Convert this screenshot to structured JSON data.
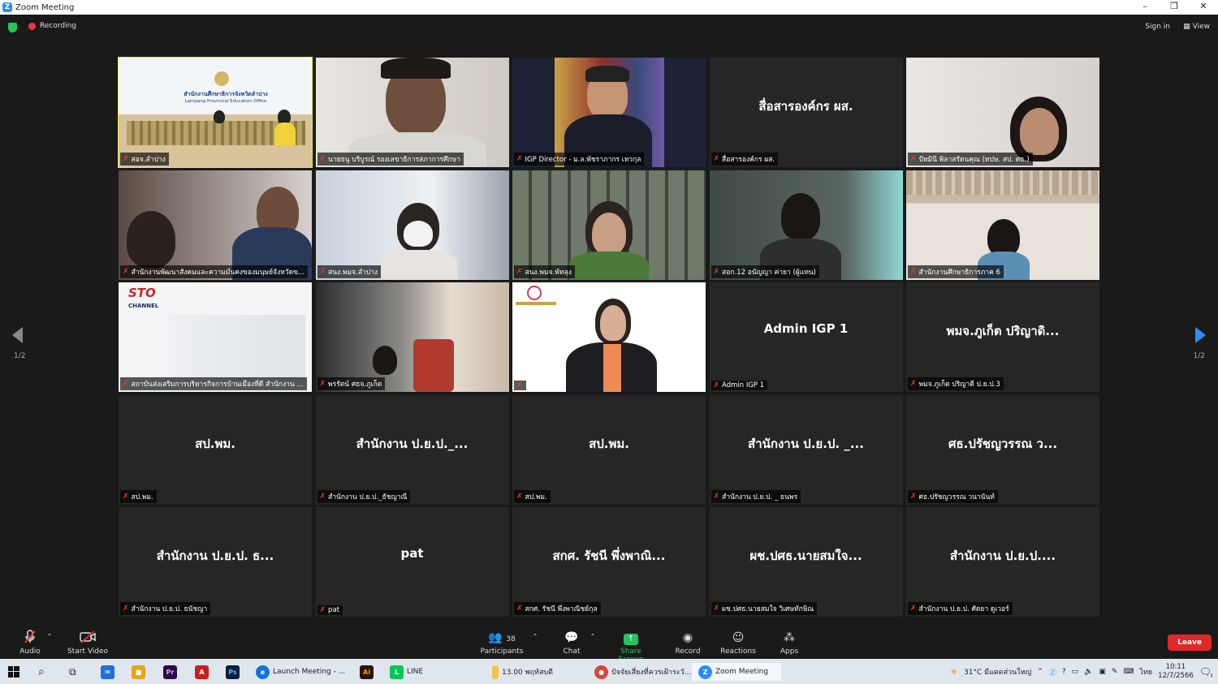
{
  "window": {
    "title": "Zoom Meeting",
    "controls": [
      "–",
      "❐",
      "✕"
    ]
  },
  "topbar": {
    "recording": "Recording",
    "signin": "Sign in",
    "view": "View"
  },
  "paging": {
    "left": "1/2",
    "right": "1/2"
  },
  "tiles": [
    {
      "name": "สอจ.ลำปาง",
      "big": "",
      "video": "room"
    },
    {
      "name": "นายธนู บริบูรณ์ รองเลขาธิการสภาการศึกษา",
      "big": "",
      "video": "man"
    },
    {
      "name": "IGP Director - ม.ล.พัชราภากร เทวกุล",
      "big": "",
      "video": "director"
    },
    {
      "name": "สื่อสารองค์กร ผส.",
      "big": "สื่อสารองค์กร ผส.",
      "video": ""
    },
    {
      "name": "ปัทมินี พิลาสรัตนคุณ (ทปษ. สป. ศธ.)",
      "big": "",
      "video": "woman"
    },
    {
      "name": "สำนักงานพัฒนาสังคมและความมั่นคงของมนุษย์จังหวัดข...",
      "big": "",
      "video": "office2"
    },
    {
      "name": "สนง.พมจ.ลำปาง",
      "big": "",
      "video": "mask"
    },
    {
      "name": "สนง.พมจ.พัทลุง",
      "big": "",
      "video": "shelf"
    },
    {
      "name": "สอก.12 อนัญญา ค่ายา (ผู้แทน)",
      "big": "",
      "video": "dim"
    },
    {
      "name": "สำนักงานศึกษาธิการภาค 6",
      "big": "",
      "video": "hall"
    },
    {
      "name": "สถาบันส่งเสริมการบริหารกิจการบ้านเมืองที่ดี สำนักงาน ...",
      "big": "",
      "video": "sto"
    },
    {
      "name": "พรรัตน์ ศธจ.ภูเก็ต",
      "big": "",
      "video": "desk"
    },
    {
      "name": "",
      "big": "",
      "video": "portrait"
    },
    {
      "name": "Admin IGP 1",
      "big": "Admin IGP 1",
      "video": ""
    },
    {
      "name": "พมจ.ภูเก็ต ปริญาดี ป.ย.ป.3",
      "big": "พมจ.ภูเก็ต ปริญาดิ...",
      "video": ""
    },
    {
      "name": "สป.พม.",
      "big": "สป.พม.",
      "video": ""
    },
    {
      "name": "สำนักงาน ป.ย.ป._ธัชญาณี",
      "big": "สำนักงาน ป.ย.ป._...",
      "video": ""
    },
    {
      "name": "สป.พม.",
      "big": "สป.พม.",
      "video": ""
    },
    {
      "name": "สำนักงาน ป.ย.ป. _ ธนพร",
      "big": "สำนักงาน ป.ย.ป. _...",
      "video": ""
    },
    {
      "name": "ศธ.ปรัชญวรรณ วนานันท์",
      "big": "ศธ.ปรัชญวรรณ ว...",
      "video": ""
    },
    {
      "name": "สำนักงาน ป.ย.ป. ธนัชญา",
      "big": "สำนักงาน ป.ย.ป. ธ...",
      "video": ""
    },
    {
      "name": "pat",
      "big": "pat",
      "video": ""
    },
    {
      "name": "สกศ. รัชนี พึ่งพาณิชย์กุล",
      "big": "สกศ. รัชนี พึ่งพาณิ...",
      "video": ""
    },
    {
      "name": "ผช.ปศธ.นายสมใจ วิเศษทักษิณ",
      "big": "ผช.ปศธ.นายสมใจ...",
      "video": ""
    },
    {
      "name": "สำนักงาน ป.ย.ป. ศัตยา ดูเวอร์",
      "big": "สำนักงาน ป.ย.ป....",
      "video": ""
    }
  ],
  "room_text": {
    "line1": "สำนักงานศึกษาธิการจังหวัดลำปาง",
    "line2": "Lampang Provincial Education Office"
  },
  "sto_text": {
    "logo": "STO",
    "sub": "CHANNEL"
  },
  "toolbar": {
    "audio": "Audio",
    "start_video": "Start Video",
    "participants": "Participants",
    "participants_count": "38",
    "chat": "Chat",
    "share_screen": "Share Screen",
    "record": "Record",
    "reactions": "Reactions",
    "apps": "Apps",
    "leave": "Leave"
  },
  "taskbar": {
    "launch": "Launch Meeting - ...",
    "line": "LINE",
    "date_item": "13.00 พฤหัสบดี",
    "chrome_tab": "ปัจจัยเสี่ยงที่ควรเฝ้าระวั...",
    "zoom": "Zoom Meeting",
    "weather": "31°C มีแดดส่วนใหญ่",
    "lang": "ไทย",
    "time": "10:11",
    "date": "12/7/2566",
    "notif": "3"
  },
  "colors": {
    "accent": "#2d8cff",
    "leave": "#e02828",
    "active_speaker": "#e6e64a",
    "share": "#23c55e"
  }
}
